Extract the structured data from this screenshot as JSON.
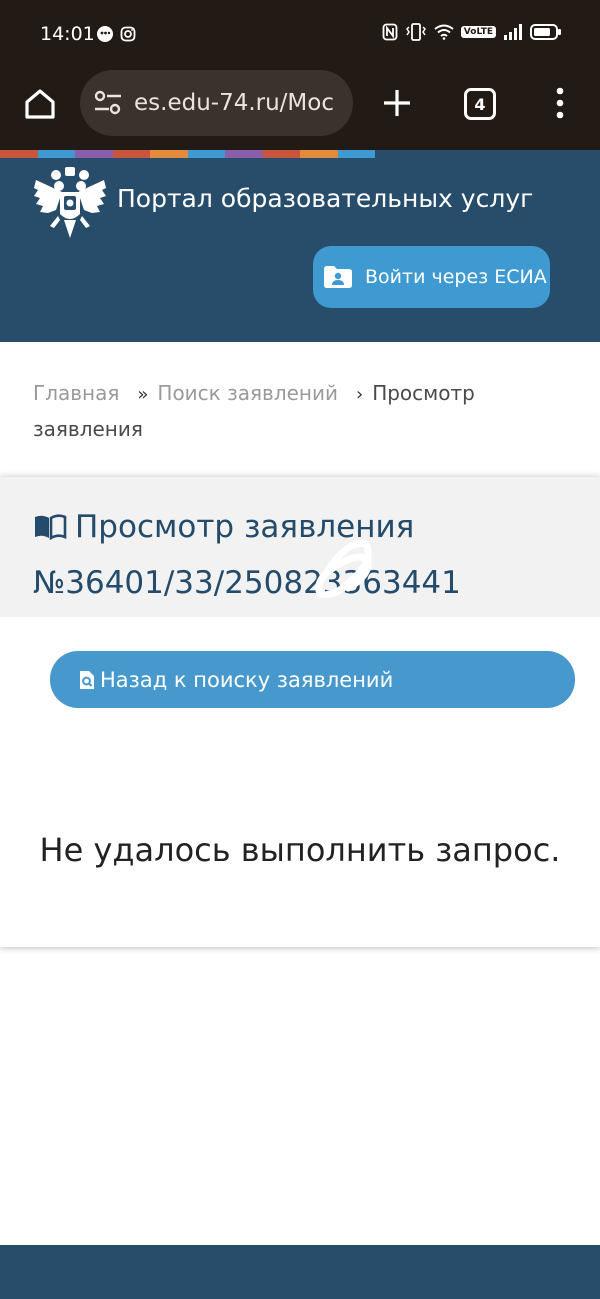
{
  "status_bar": {
    "time": "14:01",
    "volte": "VoLTE",
    "icons": [
      "chat-bubble-icon",
      "instagram-icon",
      "nfc-icon",
      "vibrate-icon",
      "wifi-icon",
      "volte-icon",
      "signal-icon",
      "battery-icon"
    ]
  },
  "browser": {
    "url": "es.edu-74.ru/Moc",
    "tab_count": "4",
    "icons": [
      "home-icon",
      "tune-icon",
      "plus-icon",
      "more-vert-icon"
    ]
  },
  "header": {
    "title": "Портал образовательных услуг",
    "login_button": "Войти через ЕСИА",
    "stripe_colors": [
      "#c8553d",
      "#3f9ad2",
      "#8a5ea8",
      "#c8553d",
      "#e28b3c",
      "#3f9ad2",
      "#8a5ea8",
      "#c8553d",
      "#e28b3c",
      "#3f9ad2"
    ],
    "background": "#284d6b"
  },
  "breadcrumb": {
    "home": "Главная",
    "search": "Поиск заявлений",
    "current": "Просмотр заявления",
    "sep1": "»",
    "sep2": "›"
  },
  "card": {
    "title": "Просмотр заявления №36401/33/250823363441",
    "back_button": "Назад к поиску заявлений",
    "error": "Не удалось выполнить запрос."
  },
  "colors": {
    "accent": "#3f9ad2",
    "title_blue": "#244b6a",
    "toolbar": "#221a14"
  }
}
